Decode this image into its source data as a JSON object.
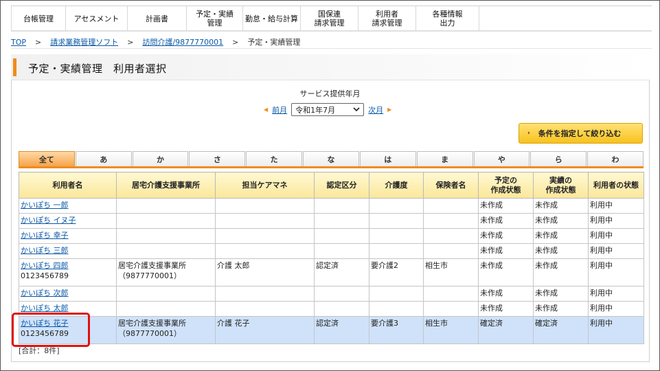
{
  "nav": {
    "items": [
      {
        "label": "台帳管理"
      },
      {
        "label": "アセスメント"
      },
      {
        "label": "計画書"
      },
      {
        "label": "予定・実績\n管理"
      },
      {
        "label": "勤怠・給与計算"
      },
      {
        "label": "国保連\n請求管理"
      },
      {
        "label": "利用者\n請求管理"
      },
      {
        "label": "各種情報\n出力"
      }
    ]
  },
  "breadcrumb": {
    "top": "TOP",
    "sep": ">",
    "billing": "請求業務管理ソフト",
    "office": "訪問介護/9877770001",
    "current": "予定・実績管理"
  },
  "page": {
    "title": "予定・実績管理　利用者選択"
  },
  "month": {
    "label": "サービス提供年月",
    "prev": "前月",
    "next": "次月",
    "selected": "令和1年7月"
  },
  "filter_button": {
    "label": "条件を指定して絞り込む"
  },
  "tabs": [
    "全て",
    "あ",
    "か",
    "さ",
    "た",
    "な",
    "は",
    "ま",
    "や",
    "ら",
    "わ"
  ],
  "table": {
    "headers": [
      "利用者名",
      "居宅介護支援事業所",
      "担当ケアマネ",
      "認定区分",
      "介護度",
      "保険者名",
      "予定の\n作成状態",
      "実績の\n作成状態",
      "利用者の状態"
    ],
    "rows": [
      {
        "name": "かいぽち 一郎",
        "id": "",
        "office": "",
        "office_code": "",
        "manager": "",
        "cert": "",
        "level": "",
        "insurer": "",
        "plan": "未作成",
        "result": "未作成",
        "status": "利用中"
      },
      {
        "name": "かいぽち イヌ子",
        "id": "",
        "office": "",
        "office_code": "",
        "manager": "",
        "cert": "",
        "level": "",
        "insurer": "",
        "plan": "未作成",
        "result": "未作成",
        "status": "利用中"
      },
      {
        "name": "かいぽち 幸子",
        "id": "",
        "office": "",
        "office_code": "",
        "manager": "",
        "cert": "",
        "level": "",
        "insurer": "",
        "plan": "未作成",
        "result": "未作成",
        "status": "利用中"
      },
      {
        "name": "かいぽち 三郎",
        "id": "",
        "office": "",
        "office_code": "",
        "manager": "",
        "cert": "",
        "level": "",
        "insurer": "",
        "plan": "未作成",
        "result": "未作成",
        "status": "利用中"
      },
      {
        "name": "かいぽち 四郎",
        "id": "0123456789",
        "office": "居宅介護支援事業所",
        "office_code": "（9877770001）",
        "manager": "介護 太郎",
        "cert": "認定済",
        "level": "要介護2",
        "insurer": "相生市",
        "plan": "未作成",
        "result": "未作成",
        "status": "利用中"
      },
      {
        "name": "かいぽち 次郎",
        "id": "",
        "office": "",
        "office_code": "",
        "manager": "",
        "cert": "",
        "level": "",
        "insurer": "",
        "plan": "未作成",
        "result": "未作成",
        "status": "利用中"
      },
      {
        "name": "かいぽち 太郎",
        "id": "",
        "office": "",
        "office_code": "",
        "manager": "",
        "cert": "",
        "level": "",
        "insurer": "",
        "plan": "未作成",
        "result": "未作成",
        "status": "利用中"
      },
      {
        "name": "かいぽち 花子",
        "id": "0123456789",
        "office": "居宅介護支援事業所",
        "office_code": "（9877770001）",
        "manager": "介護 花子",
        "cert": "認定済",
        "level": "要介護3",
        "insurer": "相生市",
        "plan": "確定済",
        "result": "確定済",
        "status": "利用中"
      }
    ]
  },
  "total": "[合計：8件]",
  "colors": {
    "accent": "#f08c1a",
    "link": "#0a58a8",
    "selected_row": "#cfe2fa",
    "header_bg": "#fbe79a",
    "highlight": "#dd1111"
  }
}
